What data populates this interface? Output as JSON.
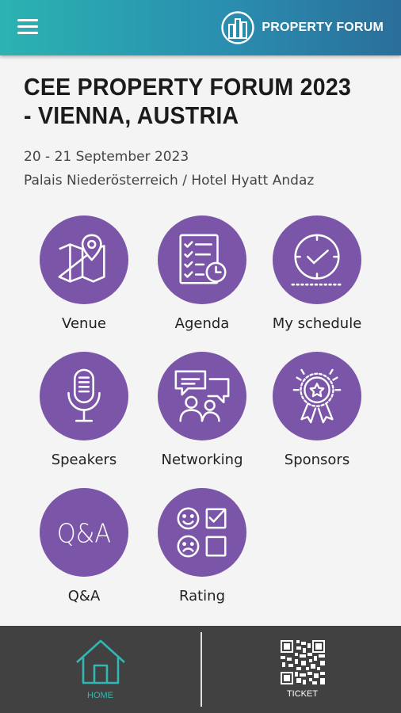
{
  "header": {
    "brand_name": "PROPERTY FORUM",
    "brand_icon": "building-logo-icon",
    "menu_icon": "hamburger-menu-icon"
  },
  "event": {
    "title_line1": "CEE PROPERTY FORUM 2023",
    "title_line2": "- VIENNA, AUSTRIA",
    "dates": "20 - 21 September 2023",
    "venue": "Palais Niederösterreich / Hotel Hyatt Andaz"
  },
  "menu_tiles": [
    {
      "label": "Venue",
      "icon": "map-pin-icon"
    },
    {
      "label": "Agenda",
      "icon": "checklist-clock-icon"
    },
    {
      "label": "My schedule",
      "icon": "clock-icon"
    },
    {
      "label": "Speakers",
      "icon": "microphone-icon"
    },
    {
      "label": "Networking",
      "icon": "chat-people-icon"
    },
    {
      "label": "Sponsors",
      "icon": "award-badge-icon"
    },
    {
      "label": "Q&A",
      "icon": "qa-text-icon"
    },
    {
      "label": "Rating",
      "icon": "rating-faces-icon"
    }
  ],
  "bottom_nav": [
    {
      "label": "HOME",
      "icon": "home-icon",
      "active": true
    },
    {
      "label": "TICKET",
      "icon": "qr-code-icon",
      "active": false
    }
  ],
  "colors": {
    "header_gradient_start": "#2bb3b1",
    "header_gradient_end": "#2a6e9a",
    "tile_purple": "#7a55a8",
    "bottom_bar": "#414141",
    "active_teal": "#32b7b3"
  }
}
